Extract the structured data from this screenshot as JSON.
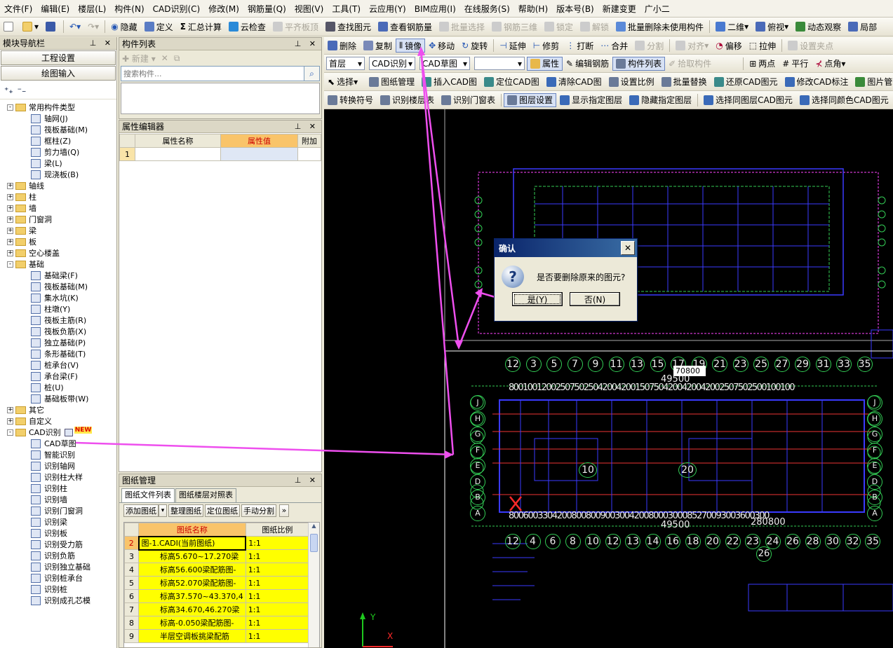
{
  "menu": [
    "文件(F)",
    "编辑(E)",
    "楼层(L)",
    "构件(N)",
    "CAD识别(C)",
    "修改(M)",
    "钢筋量(Q)",
    "视图(V)",
    "工具(T)",
    "云应用(Y)",
    "BIM应用(I)",
    "在线服务(S)",
    "帮助(H)",
    "版本号(B)",
    "新建变更",
    "广小二"
  ],
  "toolbar1": {
    "hide": "隐藏",
    "define": "定义",
    "sum_calc": "汇总计算",
    "cloud_check": "云检查",
    "flush_slab": "平齐板顶",
    "find_elem": "查找图元",
    "view_rebar": "查看钢筋量",
    "batch_select": "批量选择",
    "rebar_3d": "钢筋三维",
    "lock": "锁定",
    "unlock": "解锁",
    "batch_delete": "批量删除未使用构件",
    "view_2d": "二维",
    "top_view": "俯视",
    "dynamic_view": "动态观察",
    "local": "局部"
  },
  "toolbar2": {
    "delete": "删除",
    "copy": "复制",
    "mirror": "镜像",
    "move": "移动",
    "rotate": "旋转",
    "extend": "延伸",
    "trim": "修剪",
    "break": "打断",
    "merge": "合并",
    "split": "分割",
    "align": "对齐",
    "offset": "偏移",
    "stretch": "拉伸",
    "set_grip": "设置夹点"
  },
  "toolbar3": {
    "floor": "首层",
    "cad_recog": "CAD识别",
    "cad_draft": "CAD草图",
    "blank": "",
    "property": "属性",
    "edit_rebar": "编辑钢筋",
    "component_list": "构件列表",
    "pick": "拾取构件",
    "two_points": "两点",
    "parallel": "平行",
    "point_angle": "点角"
  },
  "toolbar4": {
    "select": "选择",
    "drawing_mgmt": "图纸管理",
    "insert_cad": "插入CAD图",
    "locate_cad": "定位CAD图",
    "clear_cad": "清除CAD图",
    "set_scale": "设置比例",
    "batch_replace": "批量替换",
    "restore_cad": "还原CAD图元",
    "modify_cad_label": "修改CAD标注",
    "image_mgmt": "图片管理"
  },
  "toolbar5": {
    "convert_symbol": "转换符号",
    "recog_floor_table": "识别楼层表",
    "recog_door_window": "识别门窗表",
    "layer_settings": "图层设置",
    "show_layer": "显示指定图层",
    "hide_layer": "隐藏指定图层",
    "select_same_layer": "选择同图层CAD图元",
    "select_same_color": "选择同颜色CAD图元"
  },
  "nav": {
    "title": "模块导航栏",
    "project_settings": "工程设置",
    "drawing_input": "绘图输入",
    "tree": [
      {
        "label": "常用构件类型",
        "level": 0,
        "exp": "-",
        "type": "folder"
      },
      {
        "label": "轴网(J)",
        "level": 1,
        "type": "item"
      },
      {
        "label": "筏板基础(M)",
        "level": 1,
        "type": "item"
      },
      {
        "label": "框柱(Z)",
        "level": 1,
        "type": "item"
      },
      {
        "label": "剪力墙(Q)",
        "level": 1,
        "type": "item"
      },
      {
        "label": "梁(L)",
        "level": 1,
        "type": "item"
      },
      {
        "label": "现浇板(B)",
        "level": 1,
        "type": "item"
      },
      {
        "label": "轴线",
        "level": 0,
        "exp": "+",
        "type": "folder"
      },
      {
        "label": "柱",
        "level": 0,
        "exp": "+",
        "type": "folder"
      },
      {
        "label": "墙",
        "level": 0,
        "exp": "+",
        "type": "folder"
      },
      {
        "label": "门窗洞",
        "level": 0,
        "exp": "+",
        "type": "folder"
      },
      {
        "label": "梁",
        "level": 0,
        "exp": "+",
        "type": "folder"
      },
      {
        "label": "板",
        "level": 0,
        "exp": "+",
        "type": "folder"
      },
      {
        "label": "空心楼盖",
        "level": 0,
        "exp": "+",
        "type": "folder"
      },
      {
        "label": "基础",
        "level": 0,
        "exp": "-",
        "type": "folder"
      },
      {
        "label": "基础梁(F)",
        "level": 1,
        "type": "item"
      },
      {
        "label": "筏板基础(M)",
        "level": 1,
        "type": "item"
      },
      {
        "label": "集水坑(K)",
        "level": 1,
        "type": "item"
      },
      {
        "label": "柱墩(Y)",
        "level": 1,
        "type": "item"
      },
      {
        "label": "筏板主筋(R)",
        "level": 1,
        "type": "item"
      },
      {
        "label": "筏板负筋(X)",
        "level": 1,
        "type": "item"
      },
      {
        "label": "独立基础(P)",
        "level": 1,
        "type": "item"
      },
      {
        "label": "条形基础(T)",
        "level": 1,
        "type": "item"
      },
      {
        "label": "桩承台(V)",
        "level": 1,
        "type": "item"
      },
      {
        "label": "承台梁(F)",
        "level": 1,
        "type": "item"
      },
      {
        "label": "桩(U)",
        "level": 1,
        "type": "item"
      },
      {
        "label": "基础板带(W)",
        "level": 1,
        "type": "item"
      },
      {
        "label": "其它",
        "level": 0,
        "exp": "+",
        "type": "folder"
      },
      {
        "label": "自定义",
        "level": 0,
        "exp": "+",
        "type": "folder"
      },
      {
        "label": "CAD识别",
        "level": 0,
        "exp": "-",
        "type": "folder",
        "badge": "NEW"
      },
      {
        "label": "CAD草图",
        "level": 1,
        "type": "item"
      },
      {
        "label": "智能识别",
        "level": 1,
        "type": "item"
      },
      {
        "label": "识别轴网",
        "level": 1,
        "type": "item"
      },
      {
        "label": "识别柱大样",
        "level": 1,
        "type": "item"
      },
      {
        "label": "识别柱",
        "level": 1,
        "type": "item"
      },
      {
        "label": "识别墙",
        "level": 1,
        "type": "item"
      },
      {
        "label": "识别门窗洞",
        "level": 1,
        "type": "item"
      },
      {
        "label": "识别梁",
        "level": 1,
        "type": "item"
      },
      {
        "label": "识别板",
        "level": 1,
        "type": "item"
      },
      {
        "label": "识别受力筋",
        "level": 1,
        "type": "item"
      },
      {
        "label": "识别负筋",
        "level": 1,
        "type": "item"
      },
      {
        "label": "识别独立基础",
        "level": 1,
        "type": "item"
      },
      {
        "label": "识别桩承台",
        "level": 1,
        "type": "item"
      },
      {
        "label": "识别桩",
        "level": 1,
        "type": "item"
      },
      {
        "label": "识别成孔芯模",
        "level": 1,
        "type": "item"
      }
    ]
  },
  "component_list": {
    "title": "构件列表",
    "new": "新建",
    "search_placeholder": "搜索构件..."
  },
  "property_editor": {
    "title": "属性编辑器",
    "col_name": "属性名称",
    "col_value": "属性值",
    "col_extra": "附加",
    "row_num": "1"
  },
  "drawing_mgmt": {
    "title": "图纸管理",
    "tab_files": "图纸文件列表",
    "tab_floor": "图纸楼层对照表",
    "btn_add": "添加图纸",
    "btn_organize": "整理图纸",
    "btn_locate": "定位图纸",
    "btn_split": "手动分割",
    "more": "»",
    "col_name": "图纸名称",
    "col_scale": "图纸比例",
    "rows": [
      {
        "n": "2",
        "name": "图-1.CADI(当前图纸)",
        "scale": "1:1"
      },
      {
        "n": "3",
        "name": "标高5.670~17.270梁",
        "scale": "1:1"
      },
      {
        "n": "4",
        "name": "标高56.600梁配筋图-",
        "scale": "1:1"
      },
      {
        "n": "5",
        "name": "标高52.070梁配筋图-",
        "scale": "1:1"
      },
      {
        "n": "6",
        "name": "标高37.570~43.370,4",
        "scale": "1:1"
      },
      {
        "n": "7",
        "name": "标高34.670,46.270梁",
        "scale": "1:1"
      },
      {
        "n": "8",
        "name": "标高-0.050梁配筋图-",
        "scale": "1:1"
      },
      {
        "n": "9",
        "name": "半层空调板挑梁配筋",
        "scale": "1:1"
      }
    ]
  },
  "canvas": {
    "dim_tooltip": "70800",
    "total_top": "49500",
    "total_bottom": "49500",
    "total_bottom2": "280800",
    "axis_top": [
      "12",
      "3",
      "5",
      "7",
      "9",
      "11",
      "13",
      "15",
      "17",
      "19",
      "21",
      "23",
      "25",
      "27",
      "29",
      "31",
      "33",
      "35"
    ],
    "axis_bottom": [
      "12",
      "4",
      "6",
      "8",
      "10",
      "12",
      "13",
      "14",
      "16",
      "18",
      "20",
      "22",
      "23",
      "24",
      "26",
      "28",
      "30",
      "32",
      "35"
    ],
    "axis_extra": "26",
    "spans_top": "8001001200250750250420042001507504200420042002507502500100100",
    "spans_bottom": "800600330420080080090030042008000300085270093003600300",
    "left_axes": [
      "J",
      "H",
      "G",
      "F",
      "E",
      "D",
      "B",
      "A"
    ],
    "right_axes": [
      "J",
      "H",
      "G",
      "F",
      "E",
      "D",
      "B",
      "A"
    ],
    "label_10": "10",
    "label_20": "20",
    "ucs_y": "Y",
    "ucs_x": "X"
  },
  "dialog": {
    "title": "确认",
    "close": "✕",
    "message": "是否要删除原来的图元?",
    "icon": "?",
    "yes": "是(Y)",
    "no": "否(N)"
  },
  "colors": {
    "accent": "#ee4fee",
    "cad_blue": "#3a3aff",
    "cad_green": "#22cc55",
    "yellow": "#ffff00"
  }
}
